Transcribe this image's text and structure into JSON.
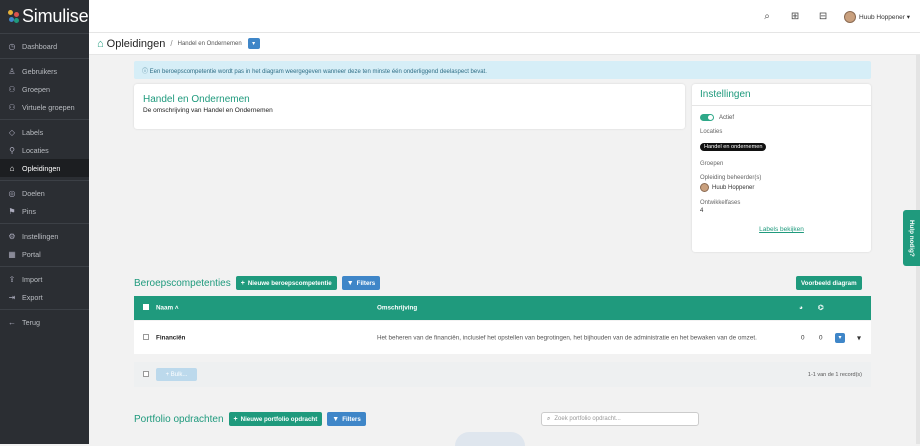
{
  "app": {
    "name": "Simulise"
  },
  "sidebar": {
    "sections": [
      [
        {
          "label": "Dashboard",
          "icon": "dashboard-icon",
          "glyph": "◷"
        }
      ],
      [
        {
          "label": "Gebruikers",
          "icon": "user-icon",
          "glyph": "♙"
        },
        {
          "label": "Groepen",
          "icon": "groups-icon",
          "glyph": "⚇"
        },
        {
          "label": "Virtuele groepen",
          "icon": "virtual-groups-icon",
          "glyph": "⚇"
        }
      ],
      [
        {
          "label": "Labels",
          "icon": "tag-icon",
          "glyph": "◇"
        },
        {
          "label": "Locaties",
          "icon": "location-icon",
          "glyph": "⚲"
        },
        {
          "label": "Opleidingen",
          "icon": "building-icon",
          "glyph": "⌂",
          "active": true
        }
      ],
      [
        {
          "label": "Doelen",
          "icon": "target-icon",
          "glyph": "◎"
        },
        {
          "label": "Pins",
          "icon": "pin-icon",
          "glyph": "⚑"
        }
      ],
      [
        {
          "label": "Instellingen",
          "icon": "gear-icon",
          "glyph": "⚙"
        },
        {
          "label": "Portal",
          "icon": "portal-icon",
          "glyph": "▦"
        }
      ],
      [
        {
          "label": "Import",
          "icon": "import-icon",
          "glyph": "⇪"
        },
        {
          "label": "Export",
          "icon": "export-icon",
          "glyph": "⇥"
        }
      ],
      [
        {
          "label": "Terug",
          "icon": "back-arrow-icon",
          "glyph": "←"
        }
      ]
    ]
  },
  "topbar": {
    "user": "Huub Hoppener ▾"
  },
  "breadcrumb": {
    "title": "Opleidingen",
    "separator": "/",
    "sub": "Handel en Ondernemen"
  },
  "alert": "ⓘ Een beroepscompetentie wordt pas in het diagram weergegeven wanneer deze ten minste één onderliggend deelaspect bevat.",
  "training": {
    "title": "Handel en Ondernemen",
    "description": "De omschrijving van Handel en Ondernemen"
  },
  "settings": {
    "title": "Instellingen",
    "active_label": "Actief",
    "locations_label": "Locaties",
    "location_pill": "Handel en ondernemen",
    "groups_label": "Groepen",
    "managers_label": "Opleiding beheerder(s)",
    "manager": "Huub Hoppener",
    "phases_label": "Ontwikkelfases",
    "phases_value": "4",
    "labels_link": "Labels bekijken"
  },
  "competencies": {
    "title": "Beroepscompetenties",
    "new_button": "Nieuwe beroepscompetentie",
    "filters_button": "Filters",
    "diagram_button": "Voorbeeld diagram",
    "columns": {
      "name": "Naam ˄",
      "description": "Omschrijving"
    },
    "rows": [
      {
        "name": "Financiën",
        "description": "Het beheren van de financiën, inclusief het opstellen van begrotingen, het bijhouden van de administratie en het bewaken van de omzet.",
        "count1": "0",
        "count2": "0"
      }
    ],
    "bulk_button": "+ Bulk...",
    "record_count": "1-1 van de 1 record(s)"
  },
  "portfolio": {
    "title": "Portfolio opdrachten",
    "new_button": "Nieuwe portfolio opdracht",
    "filters_button": "Filters",
    "search_placeholder": "Zoek portfolio opdracht..."
  },
  "help_tab": "Hulp nodig?"
}
